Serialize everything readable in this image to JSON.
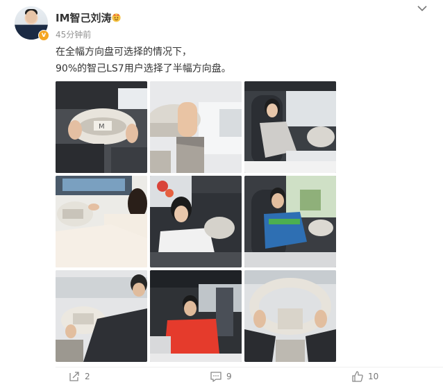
{
  "post": {
    "author": "IM智己刘涛",
    "time": "45分钟前",
    "line1": "在全幅方向盘可选择的情况下，",
    "line2": "90%的智己LS7用户选择了半幅方向盘。"
  },
  "icons": {
    "verified": "verified-badge-icon",
    "crown": "crown-emoji-icon",
    "more": "chevron-down-icon",
    "share": "share-icon",
    "comment": "comment-icon",
    "like": "like-icon"
  },
  "photos": [
    {
      "desc": "steering-yoke-closeup"
    },
    {
      "desc": "hand-on-yoke"
    },
    {
      "desc": "woman-driver-seat"
    },
    {
      "desc": "woman-hands-on-yoke"
    },
    {
      "desc": "woman-in-car"
    },
    {
      "desc": "man-blue-sweater"
    },
    {
      "desc": "man-hands-on-yoke"
    },
    {
      "desc": "man-red-jacket"
    },
    {
      "desc": "hands-on-yoke-rear-view"
    }
  ],
  "actions": {
    "share_count": "2",
    "comment_count": "9",
    "like_count": "10"
  },
  "colors": {
    "accent": "#f5a623",
    "text": "#333333",
    "muted": "#939393"
  }
}
